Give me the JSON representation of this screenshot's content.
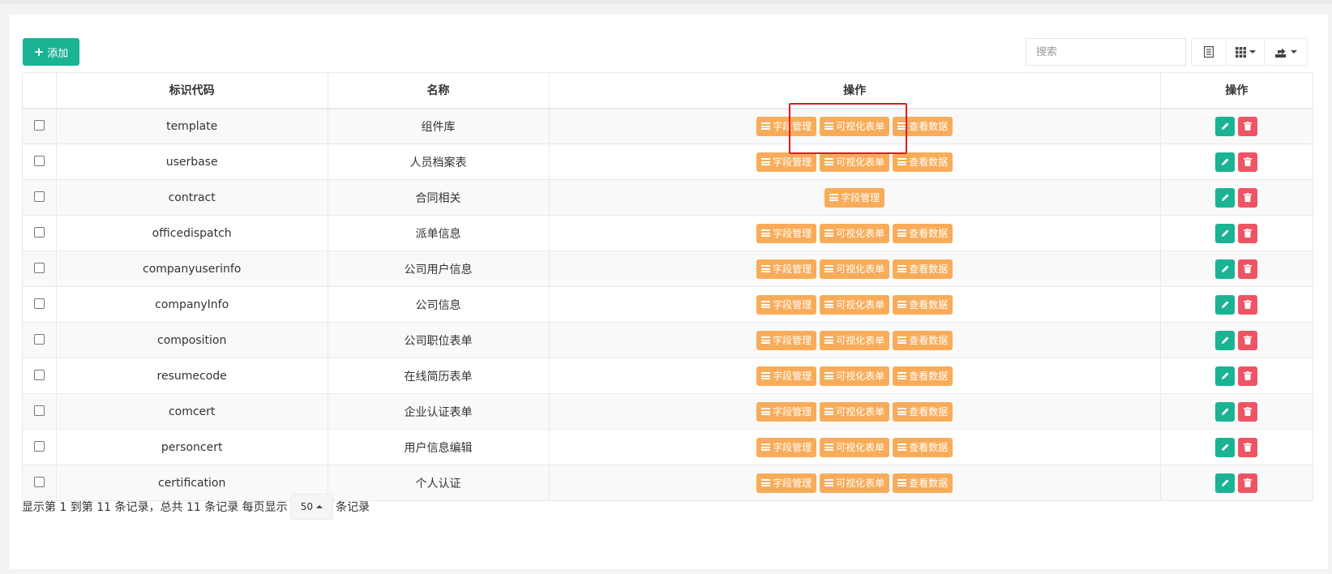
{
  "toolbar": {
    "add_label": "添加",
    "search_placeholder": "搜索",
    "buttons": [
      "toggle-view",
      "columns",
      "export"
    ]
  },
  "table": {
    "headers": [
      "标识代码",
      "名称",
      "操作",
      "操作"
    ],
    "action_labels": {
      "field": "字段管理",
      "visual": "可视化表单",
      "data": "查看数据"
    },
    "rows": [
      {
        "code": "template",
        "name": "组件库",
        "full_ops": true
      },
      {
        "code": "userbase",
        "name": "人员档案表",
        "full_ops": true
      },
      {
        "code": "contract",
        "name": "合同相关",
        "full_ops": false
      },
      {
        "code": "officedispatch",
        "name": "派单信息",
        "full_ops": true
      },
      {
        "code": "companyuserinfo",
        "name": "公司用户信息",
        "full_ops": true
      },
      {
        "code": "companyInfo",
        "name": "公司信息",
        "full_ops": true
      },
      {
        "code": "composition",
        "name": "公司职位表单",
        "full_ops": true
      },
      {
        "code": "resumecode",
        "name": "在线简历表单",
        "full_ops": true
      },
      {
        "code": "comcert",
        "name": "企业认证表单",
        "full_ops": true
      },
      {
        "code": "personcert",
        "name": "用户信息编辑",
        "full_ops": true
      },
      {
        "code": "certification",
        "name": "个人认证",
        "full_ops": true
      }
    ]
  },
  "pagination": {
    "summary": "显示第 1 到第 11 条记录，总共 11 条记录 每页显示",
    "page_size": "50",
    "suffix": "条记录"
  },
  "colors": {
    "primary": "#1ab394",
    "warning": "#f8ac59",
    "danger": "#ed5565",
    "highlight": "#e8161d"
  }
}
